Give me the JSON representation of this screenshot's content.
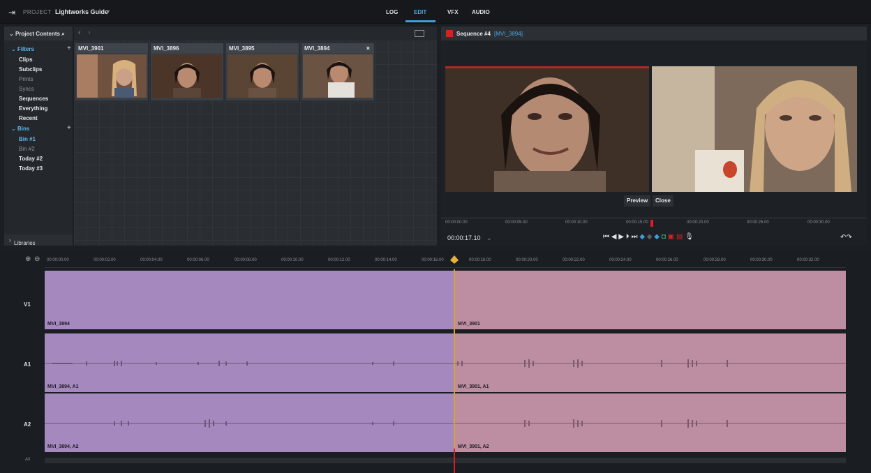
{
  "topbar": {
    "project_prefix": "PROJECT",
    "project_name": "Lightworks Guide",
    "project_dropdown": "▾",
    "tabs": [
      {
        "label": "LOG",
        "active": false
      },
      {
        "label": "EDIT",
        "active": true
      },
      {
        "label": "VFX",
        "active": false
      },
      {
        "label": "AUDIO",
        "active": false
      }
    ]
  },
  "left_panel": {
    "header": "Project Contents",
    "filters_label": "Filters",
    "filters": [
      "Clips",
      "Subclips",
      "Prints",
      "Syncs",
      "Sequences",
      "Everything",
      "Recent"
    ],
    "bins_label": "Bins",
    "bins": [
      "Bin #1",
      "Bin #2",
      "Today #2",
      "Today #3"
    ],
    "libraries_label": "Libraries"
  },
  "bin": {
    "clips": [
      {
        "name": "MVI_3901"
      },
      {
        "name": "MVI_3896"
      },
      {
        "name": "MVI_3895"
      },
      {
        "name": "MVI_3894",
        "close": "×"
      }
    ]
  },
  "viewer": {
    "sequence_name": "Sequence #4",
    "sequence_clip": "[MVI_3894]",
    "preview_label": "Preview",
    "close_label": "Close",
    "timecode": "00:00:17.10",
    "ruler_labels": [
      "00:00:00.00",
      "00:00:05.00",
      "00:00:10.00",
      "00:00:15.00",
      "00:00:20.00",
      "00:00:25.00",
      "00:00:30.00"
    ]
  },
  "timeline": {
    "ruler_labels": [
      "00:00:00.00",
      "00:00:02.00",
      "00:00:04.00",
      "00:00:06.00",
      "00:00:08.00",
      "00:00:10.00",
      "00:00:12.00",
      "00:00:14.00",
      "00:00:16.00",
      "00:00:18.00",
      "00:00:20.00",
      "00:00:22.00",
      "00:00:24.00",
      "00:00:26.00",
      "00:00:28.00",
      "00:00:30.00",
      "00:00:32.00"
    ],
    "tracks": [
      {
        "label": "V1",
        "left_clip": "MVI_3894",
        "right_clip": "MVI_3901"
      },
      {
        "label": "A1",
        "left_clip": "MVI_3894, A1",
        "right_clip": "MVI_3901, A1"
      },
      {
        "label": "A2",
        "left_clip": "MVI_3894, A2",
        "right_clip": "MVI_3901, A2"
      }
    ],
    "bottom_label": "A0"
  },
  "colors": {
    "accent": "#3d9fd8",
    "clip_purple": "#a588bd",
    "clip_pink": "#bd8da1",
    "playhead": "#d7a52d",
    "record_red": "#d3231f"
  }
}
